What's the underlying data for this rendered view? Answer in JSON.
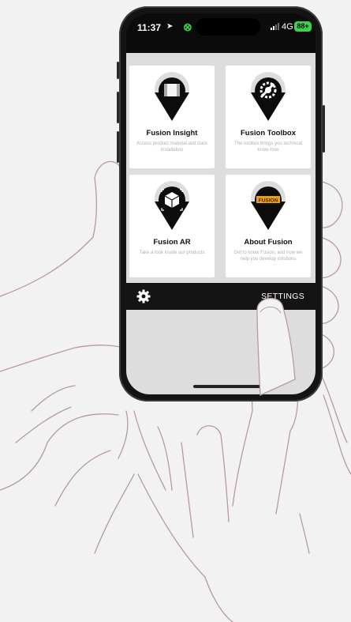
{
  "status_bar": {
    "time": "11:37",
    "location_icon": "location-arrow-icon",
    "chain_icon": "screen-sharing-icon",
    "network": "4G",
    "battery": "88+"
  },
  "tiles": [
    {
      "title": "Fusion Insight",
      "desc": "Access product material and track installation",
      "icon": "product-roll-icon"
    },
    {
      "title": "Fusion Toolbox",
      "desc": "The toolbox brings you technical know-how",
      "icon": "gear-wrench-icon"
    },
    {
      "title": "Fusion AR",
      "desc": "Take a look inside our products",
      "icon": "ar-cube-icon"
    },
    {
      "title": "About Fusion",
      "desc": "Get to know Fusion, and how we help you develop solutions",
      "icon": "fusion-logo-icon",
      "logo_text": "FUSION"
    }
  ],
  "settings": {
    "label": "SETTINGS",
    "icon": "gear-icon"
  },
  "colors": {
    "accent_green": "#3bd24e",
    "dark": "#141414",
    "panel": "#dddddd"
  }
}
